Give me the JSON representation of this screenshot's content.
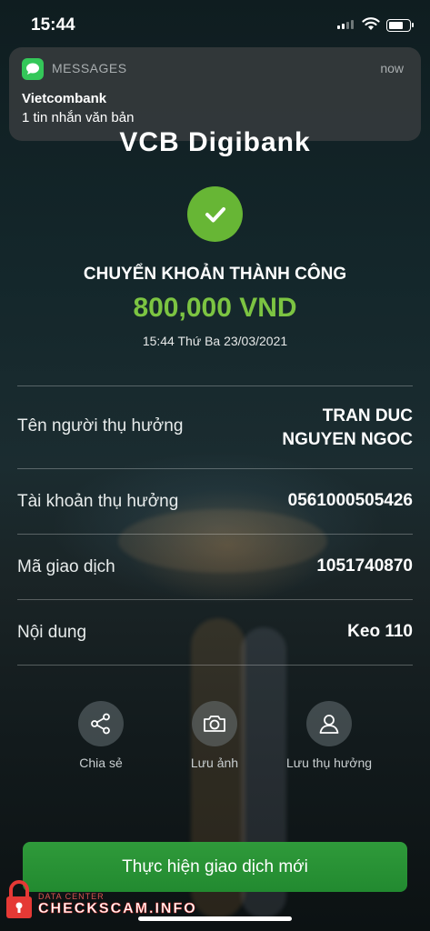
{
  "status_bar": {
    "time": "15:44"
  },
  "notification": {
    "app": "MESSAGES",
    "time": "now",
    "title": "Vietcombank",
    "body": "1 tin nhắn văn bản"
  },
  "brand": "VCB Digibank",
  "transfer": {
    "status": "CHUYỂN KHOẢN THÀNH CÔNG",
    "amount": "800,000 VND",
    "datetime": "15:44 Thứ Ba 23/03/2021"
  },
  "details": [
    {
      "label": "Tên người thụ hưởng",
      "value_line1": "TRAN DUC",
      "value_line2": "NGUYEN NGOC"
    },
    {
      "label": "Tài khoản thụ hưởng",
      "value": "0561000505426"
    },
    {
      "label": "Mã giao dịch",
      "value": "1051740870"
    },
    {
      "label": "Nội dung",
      "value": "Keo 110"
    }
  ],
  "actions": [
    {
      "label": "Chia sẻ",
      "icon": "share-icon"
    },
    {
      "label": "Lưu ảnh",
      "icon": "camera-icon"
    },
    {
      "label": "Lưu thụ hưởng",
      "icon": "person-icon"
    }
  ],
  "cta_label": "Thực hiện giao dịch mới",
  "watermark": {
    "small": "DATA CENTER",
    "big": "CHECKSCAM.INFO"
  },
  "colors": {
    "success_green": "#67b635",
    "amount_green": "#7cc442",
    "button_green": "#2a9335"
  }
}
